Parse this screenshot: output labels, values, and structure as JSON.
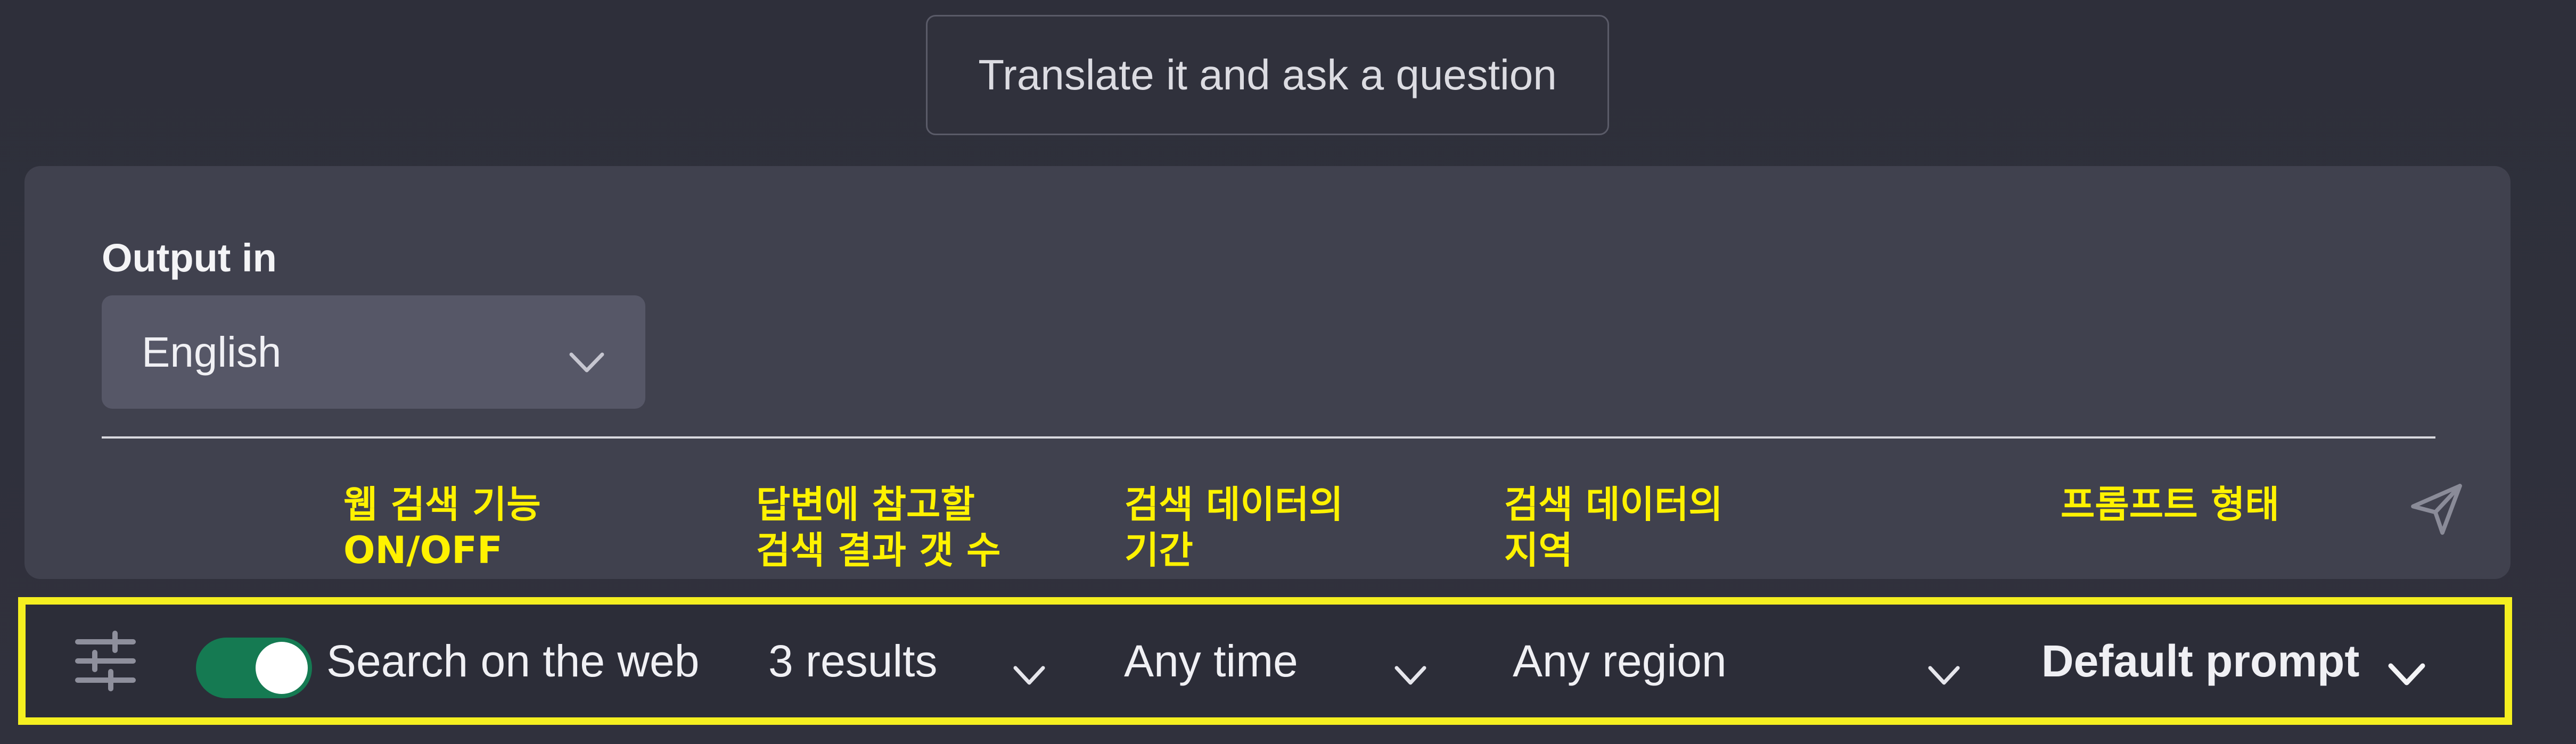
{
  "top_button": {
    "label": "Translate it and ask a question"
  },
  "output": {
    "label": "Output in",
    "selected_language": "English"
  },
  "annotations": {
    "web_search": "웹 검색 기능\nON/OFF",
    "result_count": "답변에 참고할\n검색 결과 갯 수",
    "time_range": "검색 데이터의\n기간",
    "region": "검색 데이터의\n지역",
    "prompt_type": "프롬프트 형태"
  },
  "toolbar": {
    "toggle_state": "on",
    "search_label": "Search on the web",
    "results": "3 results",
    "time": "Any time",
    "region": "Any region",
    "prompt": "Default prompt"
  },
  "colors": {
    "highlight": "#f5ef20",
    "toggle_on": "#157a52",
    "annotation_text": "#fff200"
  },
  "icons": [
    "chevron-down-icon",
    "send-icon",
    "settings-sliders-icon"
  ]
}
